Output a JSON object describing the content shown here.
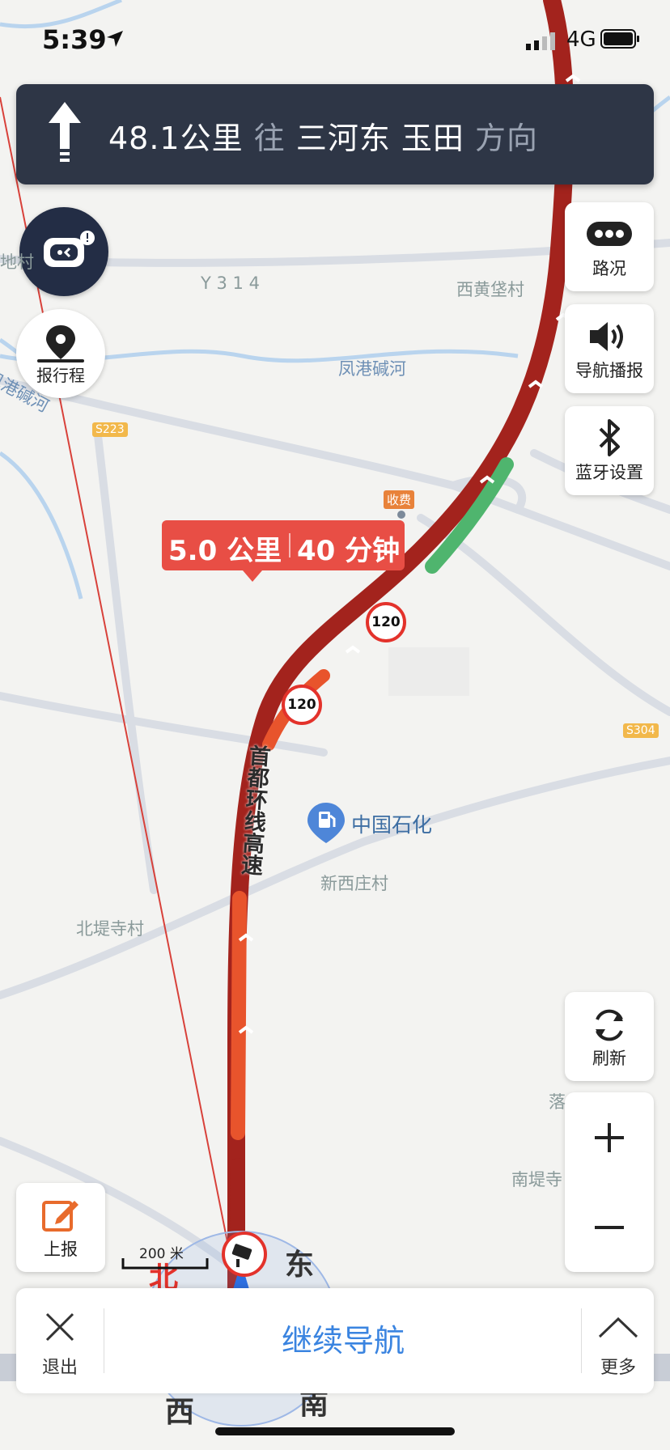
{
  "status_bar": {
    "time": "5:39",
    "network": "4G"
  },
  "guidance": {
    "distance": "48.1公里",
    "towards": "往",
    "destination": "三河东 玉田",
    "direction_word": "方向"
  },
  "buttons": {
    "report_trip": "报行程",
    "traffic": "路况",
    "voice": "导航播报",
    "bluetooth": "蓝牙设置",
    "refresh": "刷新",
    "report": "上报"
  },
  "route_callout": {
    "distance": "5.0 公里",
    "time": "40 分钟"
  },
  "speed_limits": [
    "120",
    "120"
  ],
  "map_labels": {
    "road_y314": "Y 3 1 4",
    "village_xihuangpu": "西黄垡村",
    "river": "凤港碱河",
    "river_left": "凤港碱河",
    "shield_s223": "S223",
    "shield_s304": "S304",
    "toll": "收费",
    "poi_sinopec": "中国石化",
    "village_xinxizhuang": "新西庄村",
    "village_beidisi": "北堤寺村",
    "village_nandisi": "南堤寺",
    "village_luo": "落",
    "highway_name": "首都环线高速",
    "left_edge": "地村"
  },
  "compass": {
    "north": "北",
    "east": "东",
    "west": "西",
    "south": "南"
  },
  "scale": {
    "label": "200 米"
  },
  "bottom_bar": {
    "exit": "退出",
    "continue": "继续导航",
    "more": "更多"
  },
  "colors": {
    "route_congested": "#a3231d",
    "route_slow": "#e8542c",
    "route_clear": "#4fb56e",
    "banner_bg": "#2e3646",
    "accent_blue": "#3a84e0"
  }
}
